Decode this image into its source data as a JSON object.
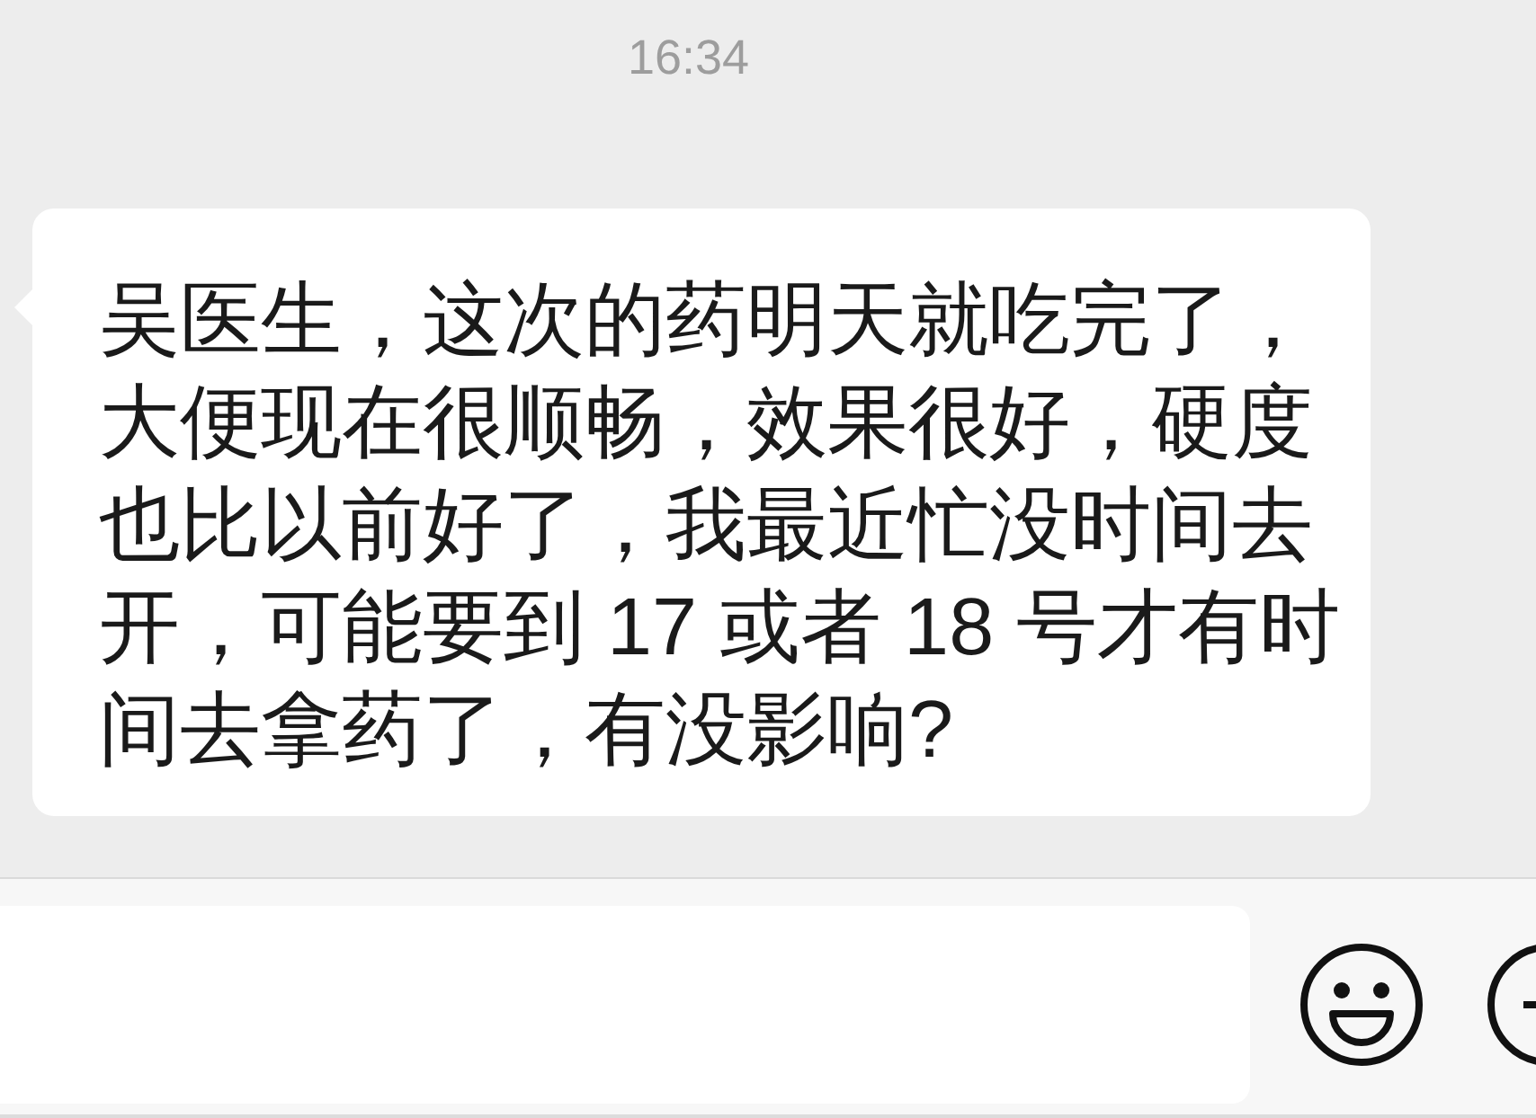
{
  "timestamp": "16:34",
  "messages": [
    {
      "kind": "received",
      "text": "吴医生，这次的药明天就吃完了，大便现在很顺畅，效果很好，硬度也比以前好了，我最近忙没时间去开，可能要到 17 或者 18 号才有时间去拿药了，有没影响?"
    }
  ]
}
